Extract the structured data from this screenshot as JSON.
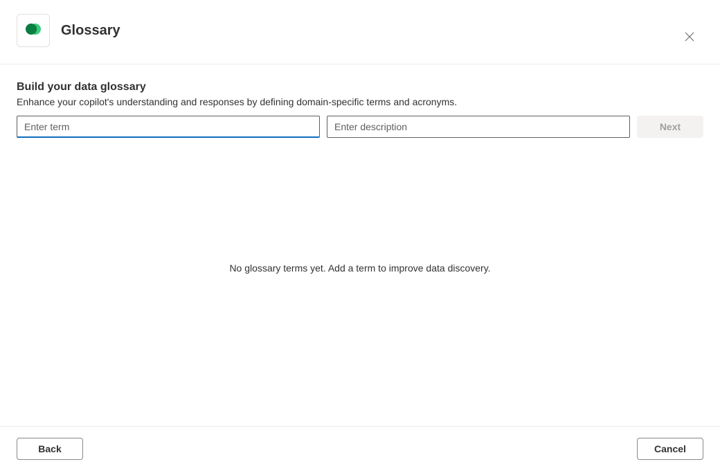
{
  "header": {
    "title": "Glossary"
  },
  "main": {
    "heading": "Build your data glossary",
    "subheading": "Enhance your copilot's understanding and responses by defining domain-specific terms and acronyms.",
    "term_placeholder": "Enter term",
    "term_value": "",
    "description_placeholder": "Enter description",
    "description_value": "",
    "next_label": "Next",
    "empty_message": "No glossary terms yet. Add a term to improve data discovery."
  },
  "footer": {
    "back_label": "Back",
    "cancel_label": "Cancel"
  },
  "icons": {
    "app": "dataverse-icon",
    "close": "close-icon"
  },
  "colors": {
    "accent": "#0f6cbd",
    "brand_green_dark": "#0a7c41",
    "brand_green_light": "#3ccb7f"
  }
}
